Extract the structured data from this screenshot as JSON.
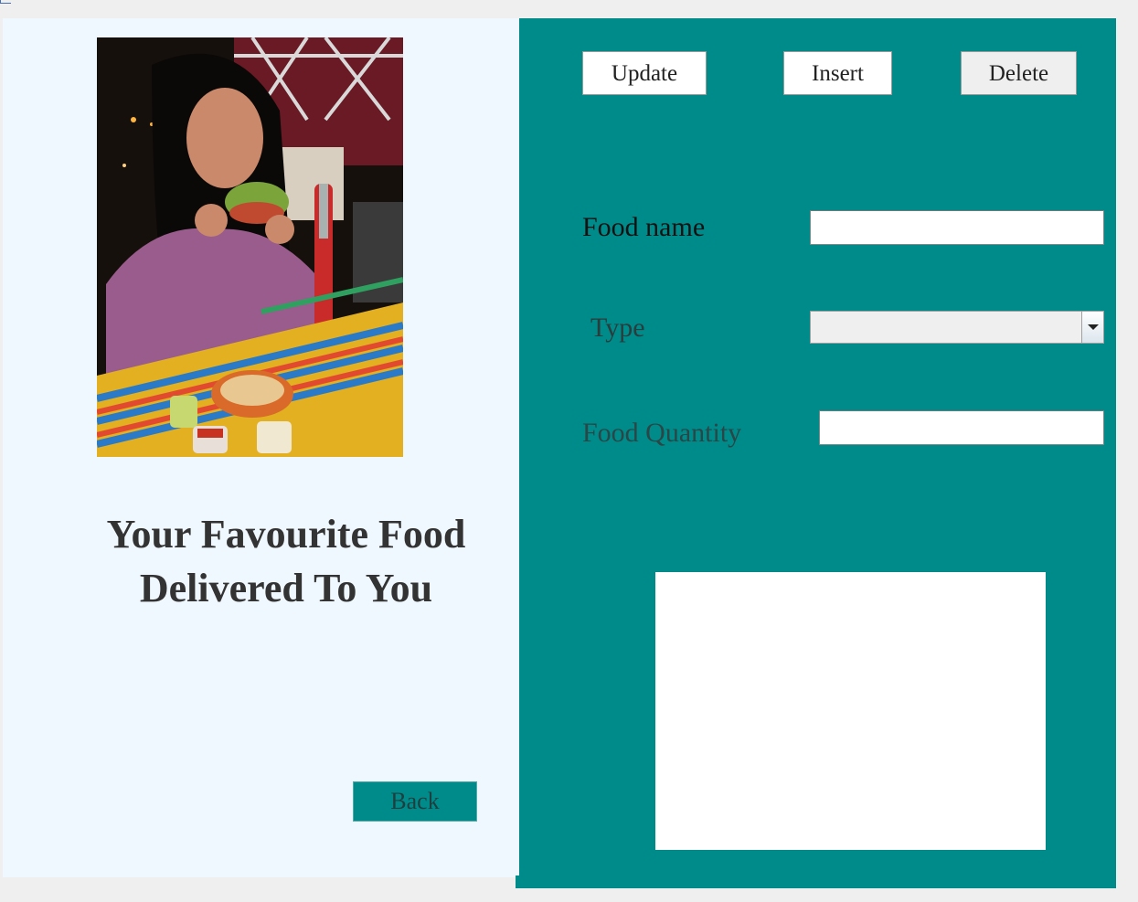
{
  "tagline": {
    "line1": "Your Favourite Food",
    "line2": "Delivered To You"
  },
  "buttons": {
    "back": "Back",
    "update": "Update",
    "insert": "Insert",
    "delete": "Delete"
  },
  "form": {
    "food_name_label": "Food name",
    "food_name_value": "",
    "type_label": "Type",
    "type_selected": "",
    "food_quantity_label": "Food Quantity",
    "food_quantity_value": ""
  },
  "images": {
    "hero": "woman-eating-taco-photo"
  },
  "colors": {
    "accent": "#008b8b",
    "left_panel_bg": "#f0f8ff",
    "window_bg": "#efefef"
  }
}
